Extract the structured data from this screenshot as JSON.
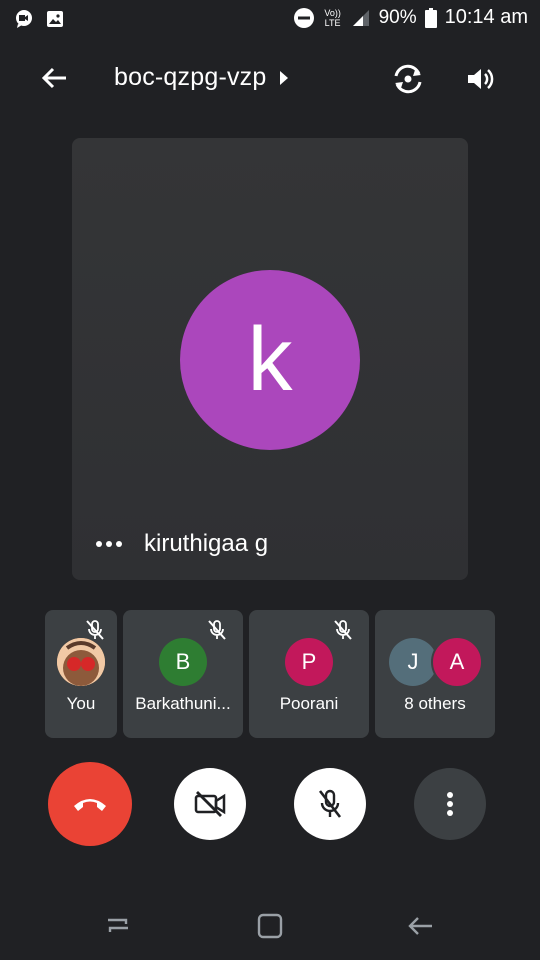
{
  "status_bar": {
    "network_label": "Vo)) LTE",
    "battery": "90%",
    "time": "10:14 am",
    "icons": [
      "meet-notification-icon",
      "gallery-icon",
      "dnd-icon",
      "signal-icon",
      "battery-icon"
    ]
  },
  "header": {
    "meeting_code": "boc-qzpg-vzp",
    "icons": [
      "back-arrow-icon",
      "chevron-right-icon",
      "switch-camera-icon",
      "speaker-icon"
    ]
  },
  "main_tile": {
    "initial": "k",
    "name": "kiruthigaa g",
    "avatar_color": "#ab47bc"
  },
  "participants": [
    {
      "label": "You",
      "type": "photo"
    },
    {
      "label": "Barkathuni...",
      "initial": "B",
      "color": "#2e7d32"
    },
    {
      "label": "Poorani",
      "initial": "P",
      "color": "#c2185b"
    },
    {
      "label": "8 others",
      "initials": [
        "J",
        "A"
      ],
      "colors": [
        "#546e7a",
        "#c2185b"
      ]
    }
  ],
  "controls": {
    "end_call_color": "#ea4335",
    "icons": [
      "end-call-icon",
      "video-off-icon",
      "mic-off-icon",
      "more-vert-icon"
    ]
  },
  "colors": {
    "background": "#202124",
    "tile": "#3c4043"
  }
}
